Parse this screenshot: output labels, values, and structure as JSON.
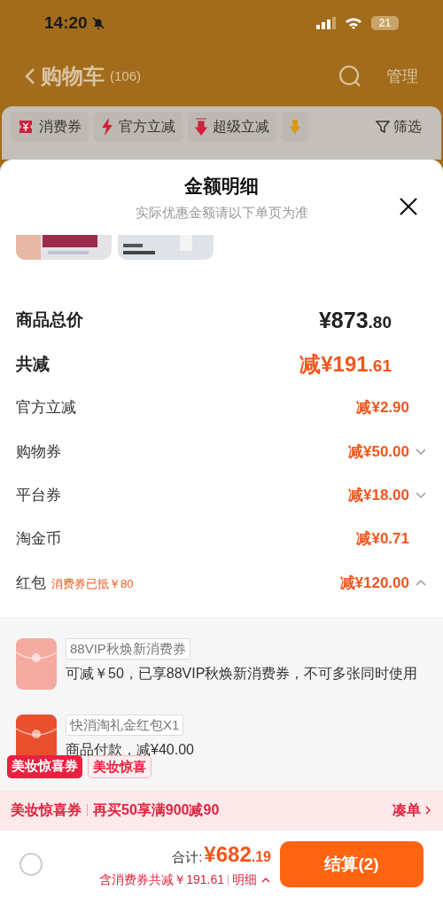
{
  "status_bar": {
    "time": "14:20",
    "battery": "21"
  },
  "header": {
    "title": "购物车",
    "count": "(106)",
    "manage": "管理"
  },
  "chips": [
    {
      "kind": "ticket",
      "label": "消费券"
    },
    {
      "kind": "bolt",
      "label": "官方立减"
    },
    {
      "kind": "down",
      "label": "超级立减"
    },
    {
      "kind": "faded"
    }
  ],
  "filter": {
    "label": "筛选"
  },
  "sheet": {
    "title": "金额明细",
    "subtitle": "实际优惠金额请以下单页为准",
    "rows": [
      {
        "kind": "total",
        "label": "商品总价",
        "amount": "¥873",
        "cents": ".80"
      },
      {
        "kind": "saving",
        "label": "共减",
        "amount": "减¥191",
        "cents": ".61"
      },
      {
        "kind": "item",
        "label": "官方立减",
        "amount": "减¥2.90"
      },
      {
        "kind": "item",
        "label": "购物券",
        "amount": "减¥50.00",
        "expanded": false
      },
      {
        "kind": "item",
        "label": "平台券",
        "amount": "减¥18.00",
        "expanded": false
      },
      {
        "kind": "item",
        "label": "淘金币",
        "amount": "减¥0.71"
      },
      {
        "kind": "item",
        "label": "红包",
        "note": "消费券已抵￥80",
        "amount": "减¥120.00",
        "expanded": true
      }
    ],
    "coupons": [
      {
        "color": "#f4aaa0",
        "tag": "88VIP秋焕新消费券",
        "text": "可减￥50，已享88VIP秋焕新消费券，不可多张同时使用"
      },
      {
        "color": "#e8502e",
        "tag": "快消淘礼金红包X1",
        "text": "商品付款，减¥40.00"
      }
    ],
    "badges": [
      {
        "kind": "filled",
        "label": "美妆惊喜券"
      },
      {
        "kind": "outline",
        "label": "美妆惊喜"
      }
    ],
    "promo": {
      "name": "美妆惊喜券",
      "offer": "再买50享满900减90",
      "action": "凑单"
    },
    "footer": {
      "selected": false,
      "total_label": "合计:",
      "total": "¥682",
      "cents": ".19",
      "saved": "含消费券共减￥191.61",
      "details": "明细",
      "checkout": "结算(2)"
    }
  }
}
